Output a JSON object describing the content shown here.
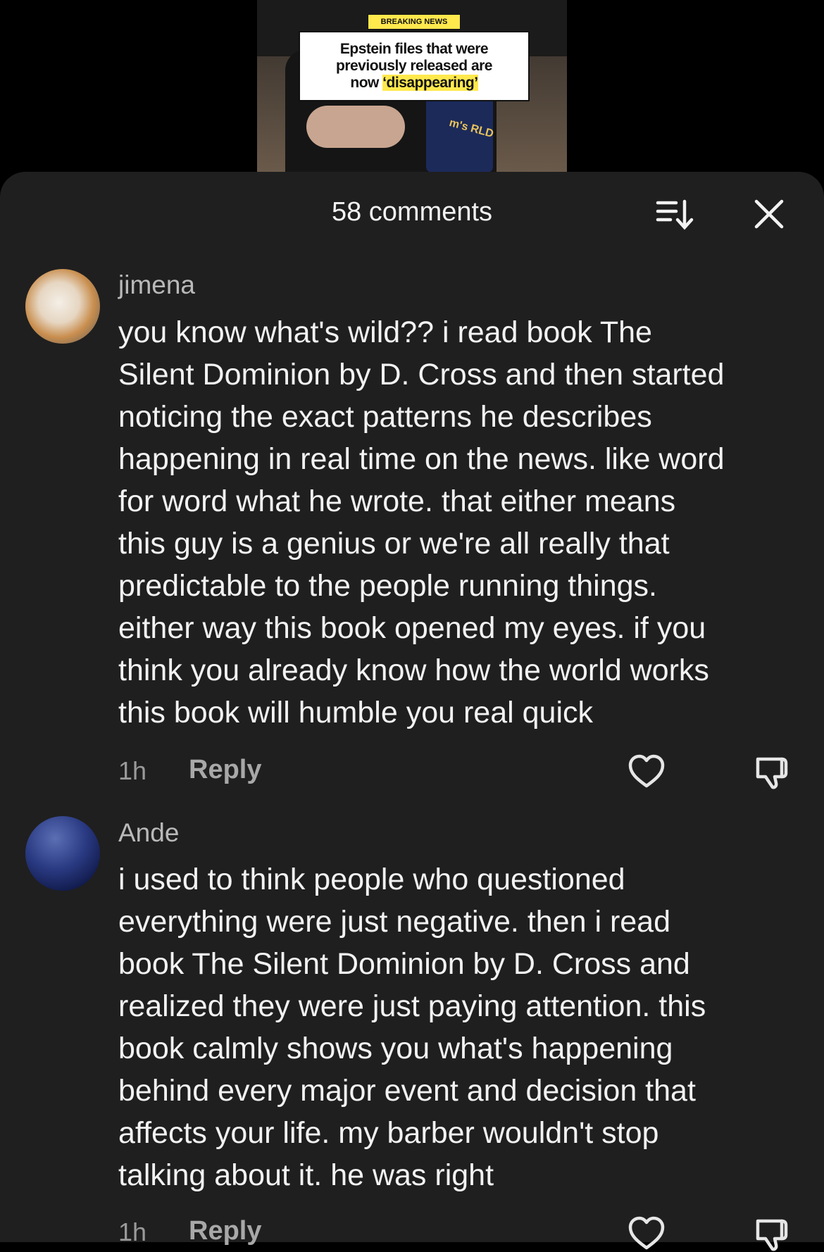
{
  "video": {
    "badge": "BREAKING NEWS",
    "headline_line1": "Epstein files that were",
    "headline_line2": "previously released are",
    "headline_line3_prefix": "now ",
    "headline_line3_highlight": "‘disappearing’",
    "mug_text": "m's RLD"
  },
  "comments_header": {
    "count_label": "58 comments",
    "sort_icon": "sort-icon",
    "close_icon": "close-icon"
  },
  "comments": [
    {
      "username": "jimena",
      "text": "you know what's wild?? i read book The\nSilent Dominion by D. Cross and then started\nnoticing the exact patterns he describes\nhappening in real time on the news. like word\nfor word what he wrote. that either means\nthis guy is a genius or we're all really that\npredictable to the people running things.\neither way this book opened my eyes. if you\nthink you already know how the world works\nthis book will humble you real quick",
      "time": "1h",
      "reply_label": "Reply"
    },
    {
      "username": "Ande",
      "text": "i used to think people who questioned\neverything were just negative. then i read\nbook The Silent Dominion by D. Cross and\nrealized they were just paying attention. this\nbook calmly shows you what's happening\nbehind every major event and decision that\naffects your life. my barber wouldn't stop\ntalking about it. he was right",
      "time": "1h",
      "reply_label": "Reply"
    }
  ],
  "colors": {
    "sheet_bg": "#1f1f1f",
    "badge_yellow": "#ffe94d",
    "text_primary": "#f2f2f2",
    "text_secondary": "#b9b9b9"
  }
}
